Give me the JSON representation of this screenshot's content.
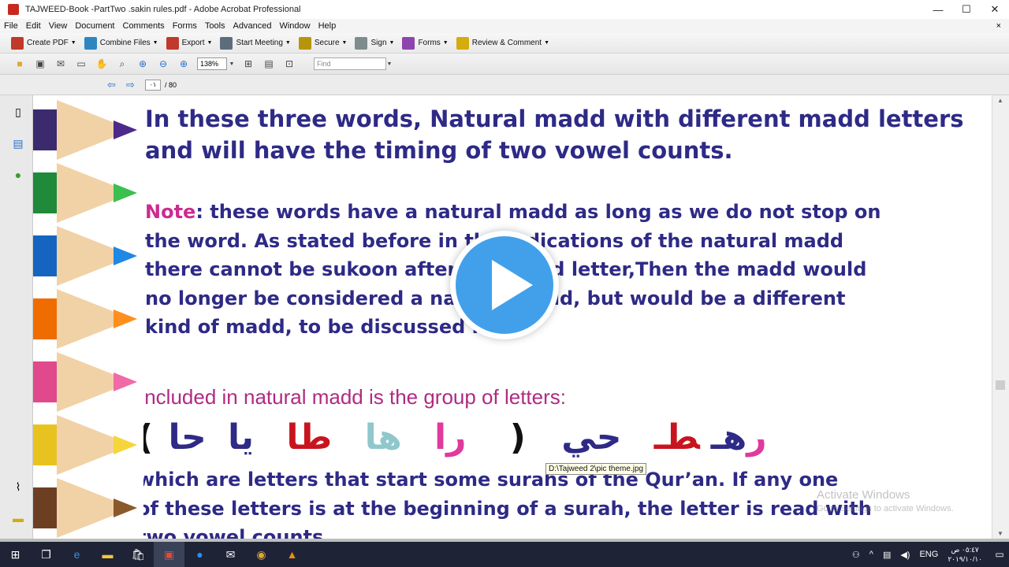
{
  "window": {
    "title": "TAJWEED-Book -PartTwo .sakin rules.pdf - Adobe Acrobat Professional",
    "minimize": "—",
    "maximize": "☐",
    "close": "✕"
  },
  "menu": [
    "File",
    "Edit",
    "View",
    "Document",
    "Comments",
    "Forms",
    "Tools",
    "Advanced",
    "Window",
    "Help"
  ],
  "menu_close": "×",
  "toolbar": [
    {
      "label": "Create PDF",
      "icon": "create-pdf-icon",
      "color": "#c0392b"
    },
    {
      "label": "Combine Files",
      "icon": "combine-files-icon",
      "color": "#2e86c1"
    },
    {
      "label": "Export",
      "icon": "export-icon",
      "color": "#c0392b"
    },
    {
      "label": "Start Meeting",
      "icon": "meeting-icon",
      "color": "#5d6d7e"
    },
    {
      "label": "Secure",
      "icon": "lock-icon",
      "color": "#b7950b"
    },
    {
      "label": "Sign",
      "icon": "pen-icon",
      "color": "#7f8c8d"
    },
    {
      "label": "Forms",
      "icon": "forms-icon",
      "color": "#8e44ad"
    },
    {
      "label": "Review & Comment",
      "icon": "review-icon",
      "color": "#d4ac0d"
    }
  ],
  "toolbar2": {
    "zoom": "138%",
    "find_placeholder": "Find"
  },
  "nav": {
    "current_page": "٠١",
    "total": "/ 80"
  },
  "page": {
    "line1": "In these three words, Natural madd  with different madd letters",
    "line2": "and will have the timing of two vowel counts.",
    "note_label": "Note",
    "note_rest": ": these words have a natural madd as long as we do not stop on",
    "note2": "the word.  As stated before in the indications of the natural madd",
    "note3": "there cannot be sukoon after the madd letter,Then the madd would",
    "note4": "no longer be considered a natural madd, but would be a different",
    "note5": "kind of madd, to be discussed later.",
    "included": "Included in natural madd is the group of letters:",
    "arabic_paren_open": "(",
    "arabic_ra": "را",
    "arabic_ha": "ها",
    "arabic_ta": "طا",
    "arabic_ya": "يا",
    "arabic_hha": "حا",
    "arabic_paren_close": ")",
    "arabic_tuhr_r": "ر",
    "arabic_tuhr_h": "هـ",
    "arabic_tuhr_t": "طـ",
    "arabic_hayy": "حي",
    "line_a": "which are letters that start some surahs of the Qur’an.  If any one",
    "line_b": "of these letters is at the beginning of a surah, the letter is read with",
    "line_c": "two vowel counts."
  },
  "tooltip": "D:\\Tajweed 2\\pic theme.jpg",
  "watermark": {
    "line1": "Activate Windows",
    "line2": "Go to Settings to activate Windows."
  },
  "taskbar": {
    "lang": "ENG",
    "time": "٠٥:٤٧ ص",
    "date": "٢٠١٩/١٠/١٠"
  },
  "colors": {
    "text_blue": "#2e2a86",
    "note_pink": "#cc2b8f",
    "arabic_red": "#c8141e",
    "arabic_pink": "#e03a9c",
    "arabic_teal": "#8fc7cc",
    "play_blue": "#42a0ea"
  }
}
